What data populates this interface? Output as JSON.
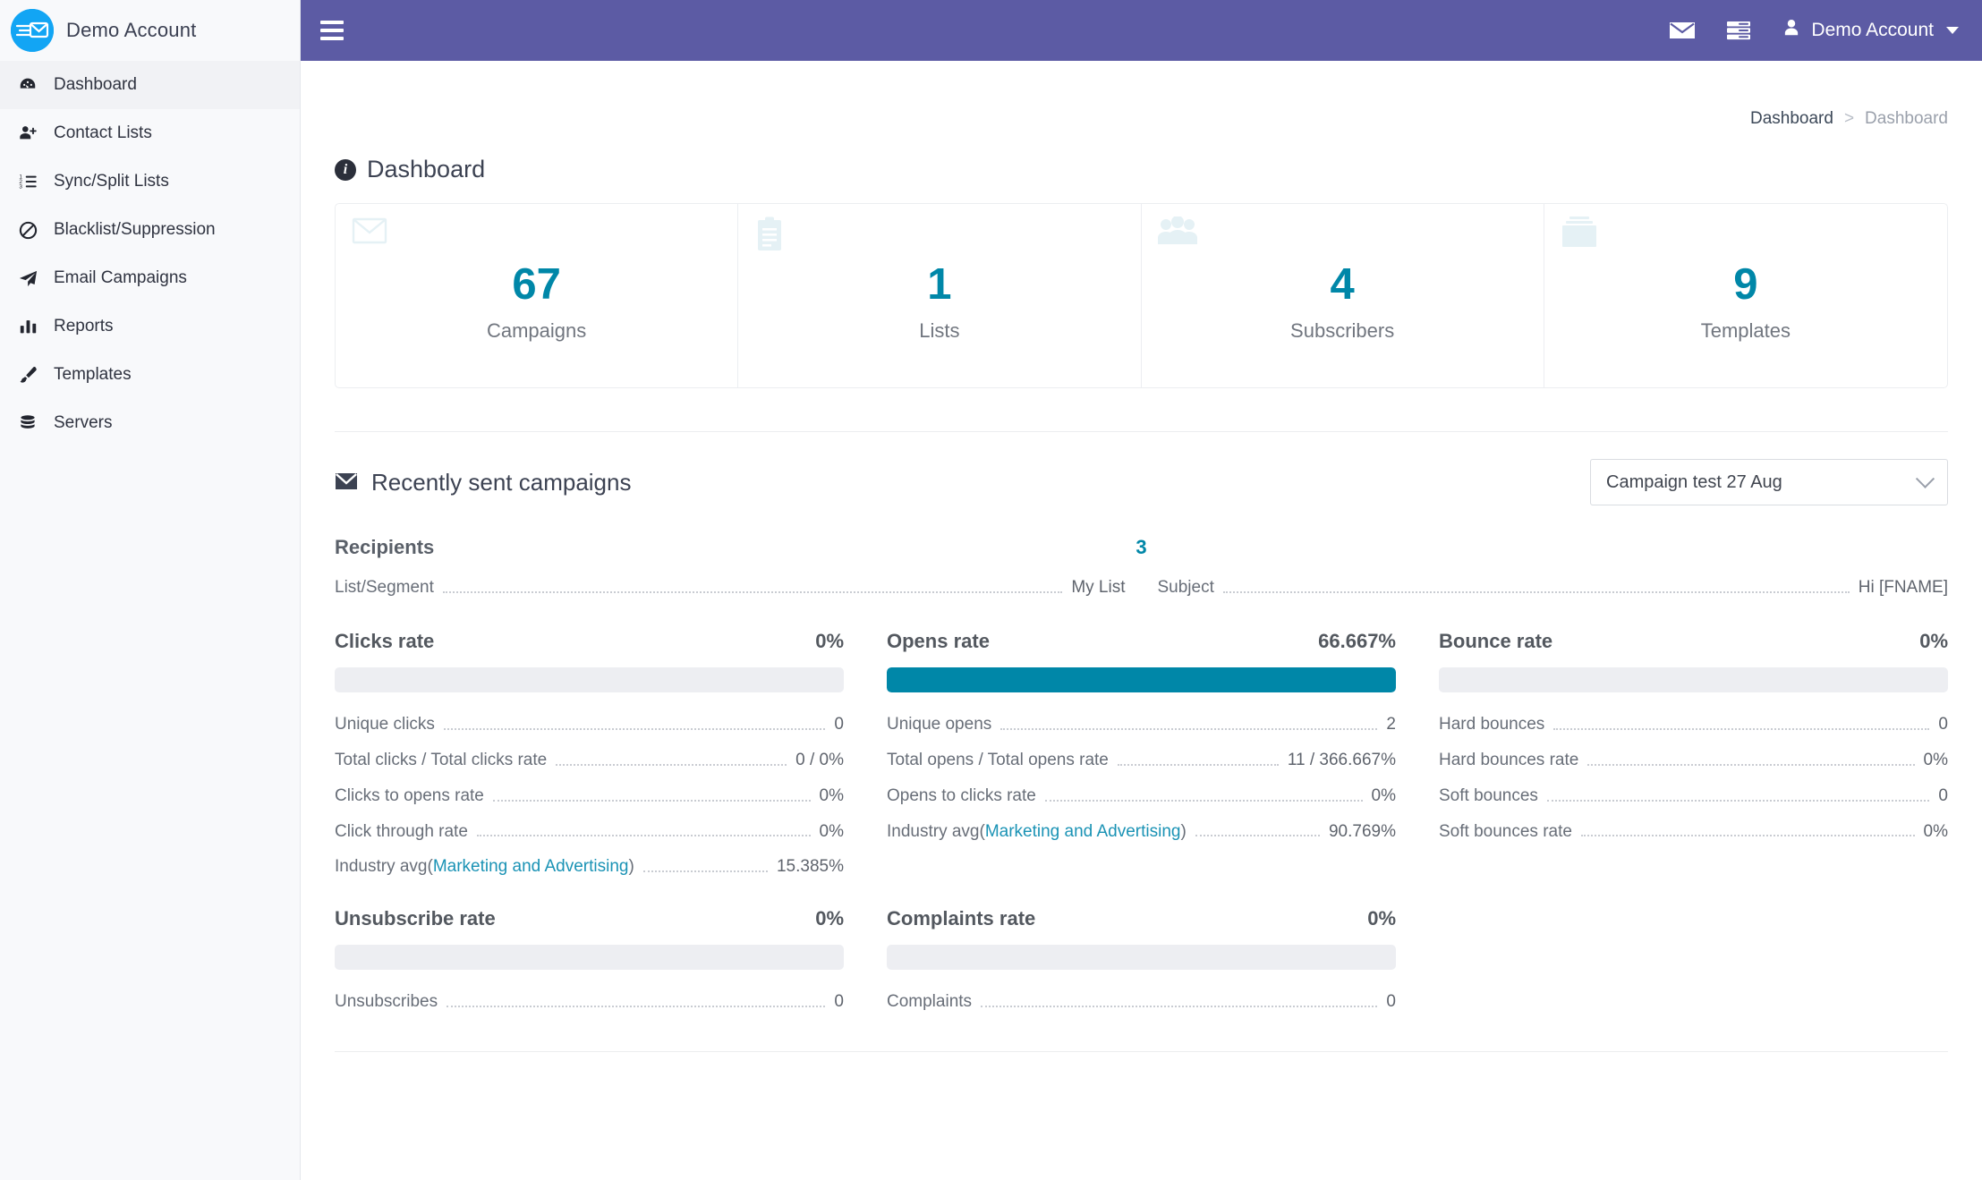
{
  "sidebar": {
    "brand": "Demo Account",
    "logo_icon": "envelope-send-icon",
    "items": [
      {
        "label": "Dashboard",
        "icon": "dashboard-gauge-icon",
        "active": true
      },
      {
        "label": "Contact Lists",
        "icon": "user-plus-icon",
        "active": false
      },
      {
        "label": "Sync/Split Lists",
        "icon": "ordered-list-icon",
        "active": false
      },
      {
        "label": "Blacklist/Suppression",
        "icon": "ban-icon",
        "active": false
      },
      {
        "label": "Email Campaigns",
        "icon": "paper-plane-icon",
        "active": false
      },
      {
        "label": "Reports",
        "icon": "bar-chart-icon",
        "active": false
      },
      {
        "label": "Templates",
        "icon": "paint-brush-icon",
        "active": false
      },
      {
        "label": "Servers",
        "icon": "database-icon",
        "active": false
      }
    ]
  },
  "topbar": {
    "background": "#5c5ba4",
    "menu_toggle_icon": "hamburger-icon",
    "mail_icon": "envelope-icon",
    "servers_icon": "server-list-icon",
    "user_icon": "user-icon",
    "user_name": "Demo Account",
    "caret_icon": "caret-down-icon"
  },
  "breadcrumb": {
    "root": "Dashboard",
    "separator": ">",
    "current": "Dashboard"
  },
  "page": {
    "title": "Dashboard",
    "title_icon": "info-circle-icon"
  },
  "stats": {
    "accent": "#0087a8",
    "cards": [
      {
        "value": "67",
        "label": "Campaigns",
        "icon": "envelope-icon"
      },
      {
        "value": "1",
        "label": "Lists",
        "icon": "clipboard-list-icon"
      },
      {
        "value": "4",
        "label": "Subscribers",
        "icon": "users-icon"
      },
      {
        "value": "9",
        "label": "Templates",
        "icon": "copy-layers-icon"
      }
    ]
  },
  "recent": {
    "title": "Recently sent campaigns",
    "title_icon": "envelope-icon",
    "selected_campaign": "Campaign test 27 Aug",
    "select_caret_icon": "chevron-down-icon",
    "recipients_label": "Recipients",
    "recipients_value": "3",
    "meta": [
      {
        "key": "List/Segment",
        "value": "My List"
      },
      {
        "key": "Subject",
        "value": "Hi [FNAME]"
      }
    ]
  },
  "rates": {
    "bar_color": "#0087a8",
    "track_color": "#edeef2",
    "row1": [
      {
        "title": "Clicks rate",
        "value": "0%",
        "percent": 0,
        "rows": [
          {
            "key": "Unique clicks",
            "value": "0"
          },
          {
            "key": "Total clicks / Total clicks rate",
            "value": "0 / 0%"
          },
          {
            "key": "Clicks to opens rate",
            "value": "0%"
          },
          {
            "key": "Click through rate",
            "value": "0%"
          },
          {
            "key_prefix": "Industry avg(",
            "key_link": "Marketing and Advertising",
            "key_suffix": ")",
            "value": "15.385%"
          }
        ]
      },
      {
        "title": "Opens rate",
        "value": "66.667%",
        "percent": 100,
        "rows": [
          {
            "key": "Unique opens",
            "value": "2"
          },
          {
            "key": "Total opens / Total opens rate",
            "value": "11 / 366.667%"
          },
          {
            "key": "Opens to clicks rate",
            "value": "0%"
          },
          {
            "key_prefix": "Industry avg(",
            "key_link": "Marketing and Advertising",
            "key_suffix": ")",
            "value": "90.769%"
          }
        ]
      },
      {
        "title": "Bounce rate",
        "value": "0%",
        "percent": 0,
        "rows": [
          {
            "key": "Hard bounces",
            "value": "0"
          },
          {
            "key": "Hard bounces rate",
            "value": "0%"
          },
          {
            "key": "Soft bounces",
            "value": "0"
          },
          {
            "key": "Soft bounces rate",
            "value": "0%"
          }
        ]
      }
    ],
    "row2": [
      {
        "title": "Unsubscribe rate",
        "value": "0%",
        "percent": 0,
        "rows": [
          {
            "key": "Unsubscribes",
            "value": "0"
          }
        ]
      },
      {
        "title": "Complaints rate",
        "value": "0%",
        "percent": 0,
        "rows": [
          {
            "key": "Complaints",
            "value": "0"
          }
        ]
      }
    ]
  }
}
